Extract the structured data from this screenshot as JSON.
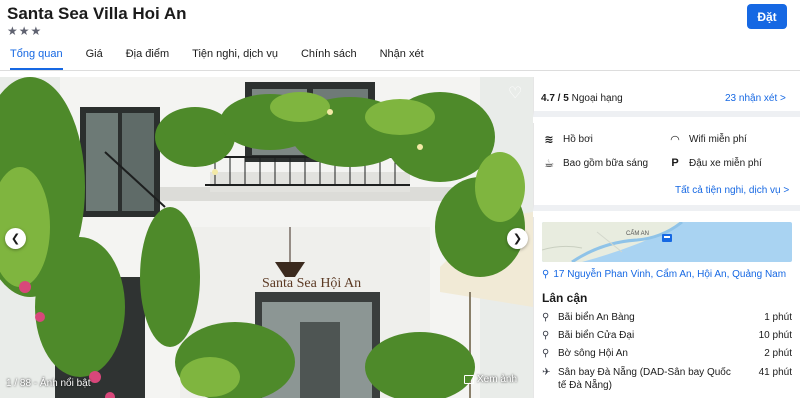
{
  "hotel": {
    "name": "Santa Sea Villa Hoi An",
    "stars": "★★★",
    "book_label": "Đặt"
  },
  "tabs": [
    {
      "label": "Tổng quan",
      "active": true
    },
    {
      "label": "Giá"
    },
    {
      "label": "Địa điểm"
    },
    {
      "label": "Tiện nghi, dịch vụ"
    },
    {
      "label": "Chính sách"
    },
    {
      "label": "Nhận xét"
    }
  ],
  "gallery": {
    "counter": "1 / 88 - Ảnh nổi bật",
    "view_label": "Xem ảnh",
    "sign_text": "Santa Sea Hội An"
  },
  "rating": {
    "score": "4.7 / 5",
    "label": "Ngoại hạng",
    "reviews_link": "23 nhận xét >"
  },
  "amenities": {
    "items": [
      {
        "icon": "pool-icon",
        "label": "Hồ bơi"
      },
      {
        "icon": "wifi-icon",
        "label": "Wifi miễn phí"
      },
      {
        "icon": "breakfast-icon",
        "label": "Bao gồm bữa sáng"
      },
      {
        "icon": "parking-icon",
        "label": "Đậu xe miễn phí"
      }
    ],
    "all_link": "Tất cả tiện nghi, dịch vụ >"
  },
  "location": {
    "map_label": "CẨM AN",
    "address": "17 Nguyễn Phan Vinh, Cẩm An, Hội An, Quảng Nam",
    "nearby_title": "Lân cận",
    "places": [
      {
        "icon": "location-pin-icon",
        "name": "Bãi biển An Bàng",
        "time": "1 phút"
      },
      {
        "icon": "location-pin-icon",
        "name": "Bãi biển Cửa Đại",
        "time": "10 phút"
      },
      {
        "icon": "location-pin-icon",
        "name": "Bờ sông Hội An",
        "time": "2 phút"
      },
      {
        "icon": "airplane-icon",
        "name": "Sân bay Đà Nẵng (DAD-Sân bay Quốc tế Đà Nẵng)",
        "time": "41 phút"
      }
    ]
  },
  "colors": {
    "accent": "#1668e3",
    "text": "#1b1b1b",
    "divider": "#eef0f3"
  }
}
